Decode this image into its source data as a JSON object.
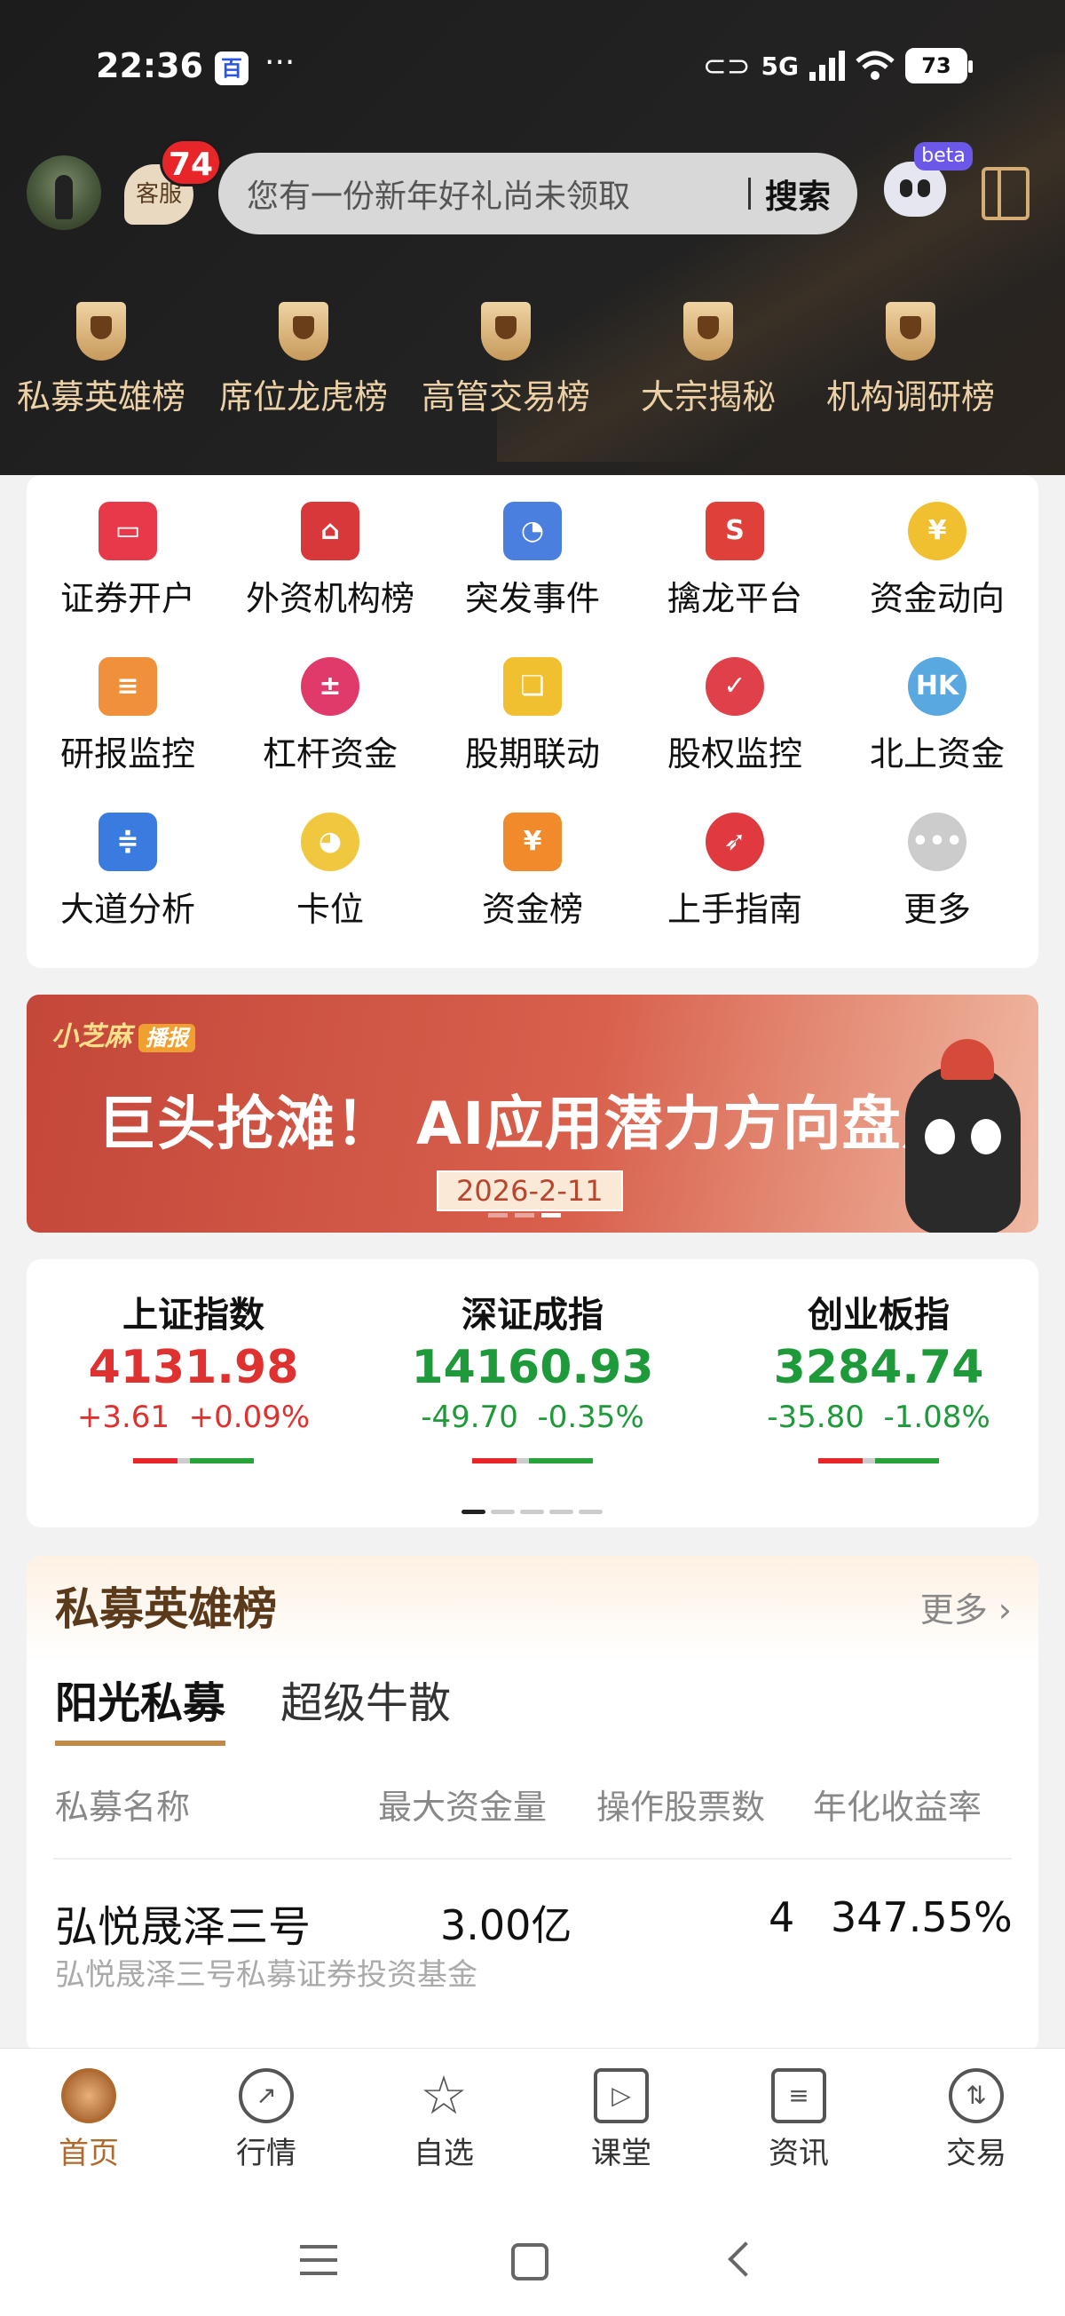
{
  "status_bar": {
    "time": "22:36",
    "network": "5G",
    "battery": "73"
  },
  "header": {
    "kefu_label": "客服",
    "kefu_badge": "74",
    "search_placeholder": "您有一份新年好礼尚未领取",
    "search_button": "搜索",
    "beta_label": "beta"
  },
  "rank_menu": [
    {
      "label": "私募英雄榜"
    },
    {
      "label": "席位龙虎榜"
    },
    {
      "label": "高管交易榜"
    },
    {
      "label": "大宗揭秘"
    },
    {
      "label": "机构调研榜"
    }
  ],
  "function_grid": [
    {
      "label": "证券开户",
      "color": "#e8394a",
      "glyph": "▭"
    },
    {
      "label": "外资机构榜",
      "color": "#d8383a",
      "glyph": "⌂"
    },
    {
      "label": "突发事件",
      "color": "#4a7fe0",
      "glyph": "◔"
    },
    {
      "label": "擒龙平台",
      "color": "#e0403a",
      "glyph": "S"
    },
    {
      "label": "资金动向",
      "color": "#f0c030",
      "glyph": "¥"
    },
    {
      "label": "研报监控",
      "color": "#f0903a",
      "glyph": "≡"
    },
    {
      "label": "杠杆资金",
      "color": "#e03a6a",
      "glyph": "±"
    },
    {
      "label": "股期联动",
      "color": "#f0c030",
      "glyph": "❏"
    },
    {
      "label": "股权监控",
      "color": "#e0404a",
      "glyph": "✓"
    },
    {
      "label": "北上资金",
      "color": "#5aa8e0",
      "glyph": "HK"
    },
    {
      "label": "大道分析",
      "color": "#3a7be0",
      "glyph": "≑"
    },
    {
      "label": "卡位",
      "color": "#f0c840",
      "glyph": "◕"
    },
    {
      "label": "资金榜",
      "color": "#f08a2a",
      "glyph": "¥"
    },
    {
      "label": "上手指南",
      "color": "#e03a40",
      "glyph": "➶"
    },
    {
      "label": "更多",
      "color": "#cccccc",
      "glyph": "•••"
    }
  ],
  "banner": {
    "tag": "小芝麻",
    "tag_badge": "播报",
    "title": "巨头抢滩！ AI应用潜力方向盘点",
    "date": "2026-2-11"
  },
  "indices": [
    {
      "name": "上证指数",
      "value": "4131.98",
      "change": "+3.61",
      "pct": "+0.09%",
      "dir": "up"
    },
    {
      "name": "深证成指",
      "value": "14160.93",
      "change": "-49.70",
      "pct": "-0.35%",
      "dir": "down"
    },
    {
      "name": "创业板指",
      "value": "3284.74",
      "change": "-35.80",
      "pct": "-1.08%",
      "dir": "down"
    }
  ],
  "fund_board": {
    "title": "私募英雄榜",
    "more": "更多",
    "tabs": [
      "阳光私募",
      "超级牛散"
    ],
    "columns": [
      "私募名称",
      "最大资金量",
      "操作股票数",
      "年化收益率"
    ],
    "rows": [
      {
        "name": "弘悦晟泽三号",
        "full_name": "弘悦晟泽三号私募证券投资基金",
        "max_fund": "3.00亿",
        "stock_count": "4",
        "annual_return": "347.55%"
      }
    ]
  },
  "bottom_nav": [
    {
      "label": "首页",
      "active": true
    },
    {
      "label": "行情"
    },
    {
      "label": "自选"
    },
    {
      "label": "课堂"
    },
    {
      "label": "资讯"
    },
    {
      "label": "交易"
    }
  ]
}
